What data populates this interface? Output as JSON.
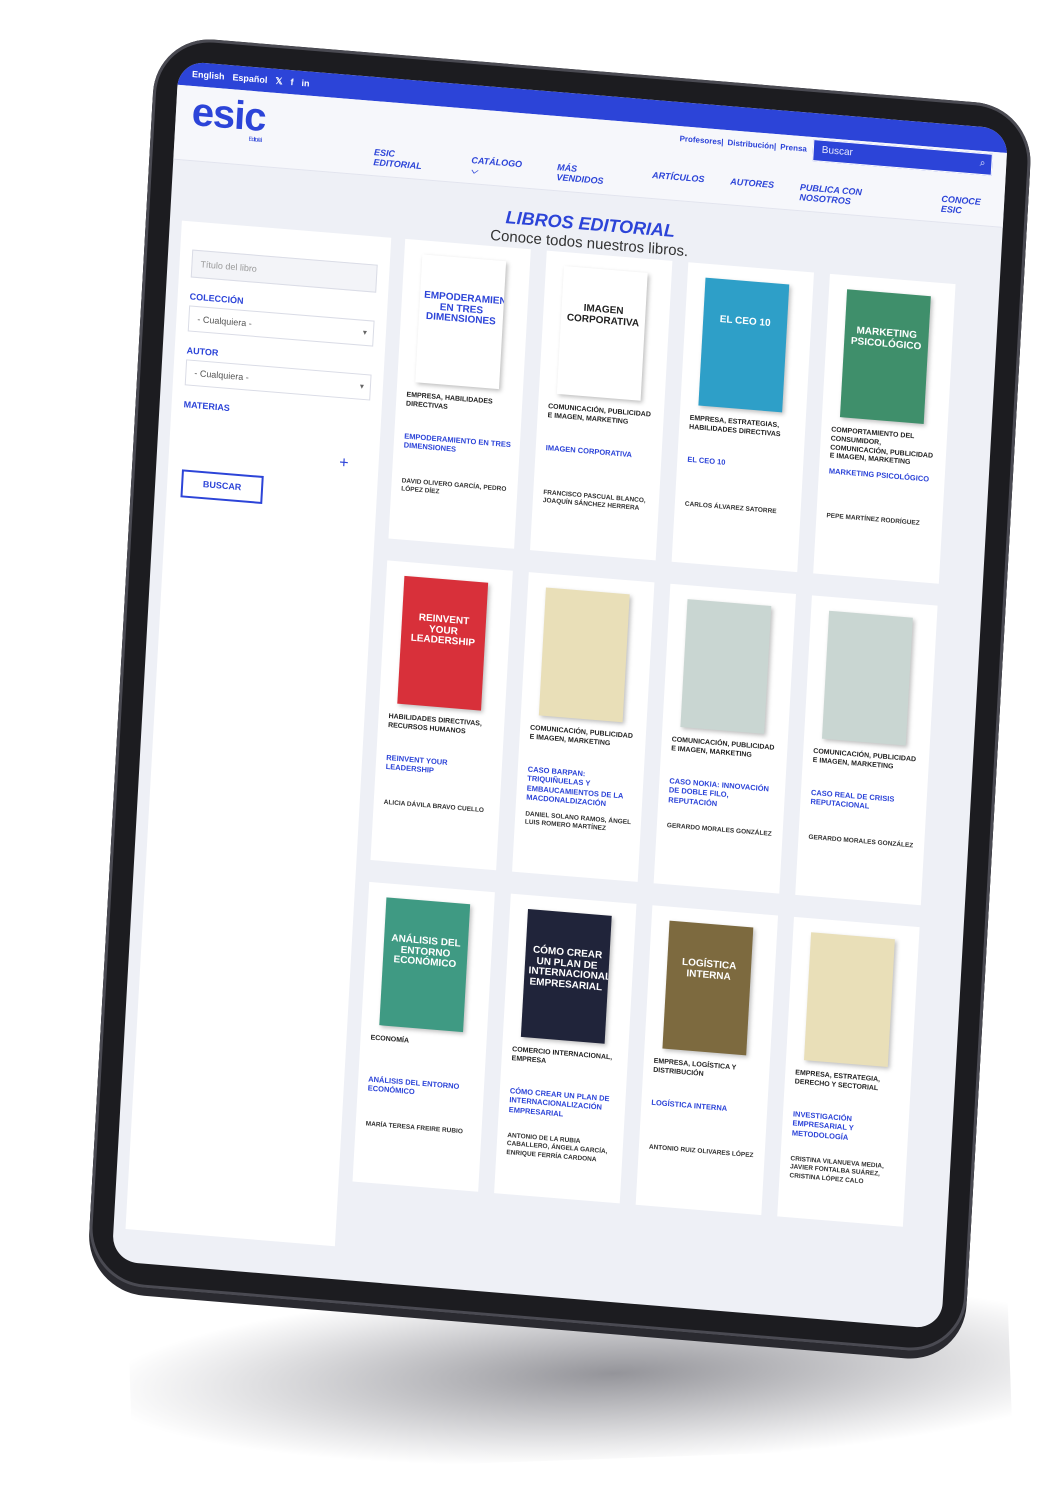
{
  "topbar": {
    "lang_en": "English",
    "lang_es": "Español",
    "twitter": "twitter-icon",
    "facebook": "facebook-icon",
    "linkedin": "linkedin-icon"
  },
  "header": {
    "logo": "esic",
    "logo_sub": "Editorial",
    "util_links": [
      "Profesores|",
      "Distribución|",
      "Prensa"
    ],
    "search_placeholder": "Buscar",
    "nav": [
      "ESIC EDITORIAL",
      "CATÁLOGO ⌵",
      "MÁS VENDIDOS",
      "ARTÍCULOS",
      "AUTORES",
      "PUBLICA CON NOSOTROS",
      "CONOCE ESIC"
    ]
  },
  "heading": {
    "title": "LIBROS EDITORIAL",
    "subtitle": "Conoce todos nuestros libros."
  },
  "filters": {
    "title_placeholder": "Título del libro",
    "coleccion_label": "COLECCIÓN",
    "coleccion_value": "- Cualquiera -",
    "autor_label": "AUTOR",
    "autor_value": "- Cualquiera -",
    "materias_label": "MATERIAS",
    "plus": "+",
    "button": "BUSCAR"
  },
  "books": [
    {
      "cover": "EMPODERAMIENTO EN TRES DIMENSIONES",
      "color": "#ffffff",
      "text": "#2c44d8",
      "category": "EMPRESA, HABILIDADES DIRECTIVAS",
      "title": "EMPODERAMIENTO EN TRES DIMENSIONES",
      "author": "DAVID OLIVERO GARCÍA, PEDRO LÓPEZ DÍEZ"
    },
    {
      "cover": "IMAGEN CORPORATIVA",
      "color": "#ffffff",
      "text": "#222222",
      "category": "COMUNICACIÓN, PUBLICIDAD E IMAGEN, MARKETING",
      "title": "IMAGEN CORPORATIVA",
      "author": "FRANCISCO PASCUAL BLANCO, JOAQUÍN SÁNCHEZ HERRERA"
    },
    {
      "cover": "EL CEO 10",
      "color": "#2e9fc8",
      "text": "#ffffff",
      "category": "EMPRESA, ESTRATEGIAS, HABILIDADES DIRECTIVAS",
      "title": "EL CEO 10",
      "author": "CARLOS ÁLVAREZ SATORRE"
    },
    {
      "cover": "MARKETING PSICOLÓGICO",
      "color": "#3f8f6b",
      "text": "#ffffff",
      "category": "COMPORTAMIENTO DEL CONSUMIDOR, COMUNICACIÓN, PUBLICIDAD E IMAGEN, MARKETING",
      "title": "MARKETING PSICOLÓGICO",
      "author": "PEPE MARTÍNEZ RODRÍGUEZ"
    },
    {
      "cover": "REINVENT YOUR LEADERSHIP",
      "color": "#d8303a",
      "text": "#ffffff",
      "category": "HABILIDADES DIRECTIVAS, RECURSOS HUMANOS",
      "title": "REINVENT YOUR LEADERSHIP",
      "author": "ALICIA DÁVILA BRAVO CUELLO"
    },
    {
      "cover": "",
      "color": "#e9dfb8",
      "text": "#444444",
      "category": "COMUNICACIÓN, PUBLICIDAD E IMAGEN, MARKETING",
      "title": "CASO BARPAN: TRIQUIÑUELAS Y EMBAUCAMIENTOS DE LA MACDONALDIZACIÓN",
      "author": "DANIEL SOLANO RAMOS, ÁNGEL LUIS ROMERO MARTÍNEZ"
    },
    {
      "cover": "",
      "color": "#c9d6d2",
      "text": "#444444",
      "category": "COMUNICACIÓN, PUBLICIDAD E IMAGEN, MARKETING",
      "title": "CASO NOKIA: INNOVACIÓN DE DOBLE FILO, REPUTACIÓN",
      "author": "GERARDO MORALES GONZÁLEZ"
    },
    {
      "cover": "",
      "color": "#c9d6d2",
      "text": "#444444",
      "category": "COMUNICACIÓN, PUBLICIDAD E IMAGEN, MARKETING",
      "title": "CASO REAL DE CRISIS REPUTACIONAL",
      "author": "GERARDO MORALES GONZÁLEZ"
    },
    {
      "cover": "ANÁLISIS DEL ENTORNO ECONÓMICO",
      "color": "#3f9a83",
      "text": "#ffffff",
      "category": "ECONOMÍA",
      "title": "ANÁLISIS DEL ENTORNO ECONÓMICO",
      "author": "MARÍA TERESA FREIRE RUBIO"
    },
    {
      "cover": "CÓMO CREAR UN PLAN DE INTERNACIONALIZACIÓN EMPRESARIAL",
      "color": "#20243a",
      "text": "#ffffff",
      "category": "COMERCIO INTERNACIONAL, EMPRESA",
      "title": "CÓMO CREAR UN PLAN DE INTERNACIONALIZACIÓN EMPRESARIAL",
      "author": "ANTONIO DE LA RUBIA CABALLERO, ÁNGELA GARCÍA, ENRIQUE FERRÍA CARDONA"
    },
    {
      "cover": "LOGÍSTICA INTERNA",
      "color": "#7d6a3f",
      "text": "#ffffff",
      "category": "EMPRESA, LOGÍSTICA Y DISTRIBUCIÓN",
      "title": "LOGÍSTICA INTERNA",
      "author": "ANTONIO RUIZ OLIVARES LÓPEZ"
    },
    {
      "cover": "",
      "color": "#e9dfb8",
      "text": "#444444",
      "category": "EMPRESA, ESTRATEGIA, DERECHO Y SECTORIAL",
      "title": "INVESTIGACIÓN EMPRESARIAL Y METODOLOGÍA",
      "author": "CRISTINA VILANUEVA MEDIA, JAVIER FONTALBA SUÁREZ, CRISTINA LÓPEZ CALO"
    }
  ],
  "colors": {
    "brand": "#2c44d8",
    "frame": "#1c1c20"
  }
}
